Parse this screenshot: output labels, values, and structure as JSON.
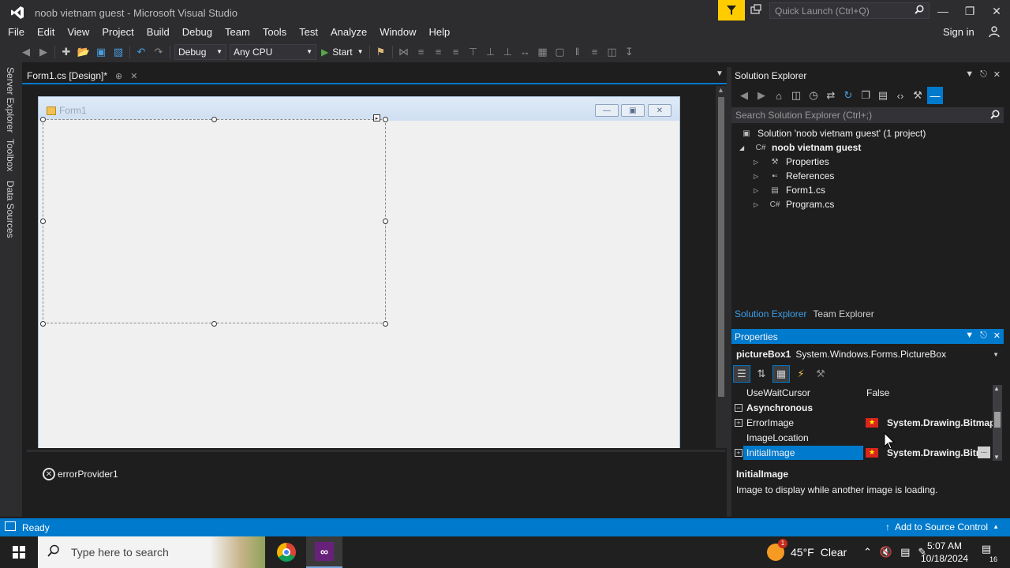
{
  "window": {
    "title": "noob vietnam guest - Microsoft Visual Studio"
  },
  "quick_launch": {
    "placeholder": "Quick Launch (Ctrl+Q)"
  },
  "menu": [
    "File",
    "Edit",
    "View",
    "Project",
    "Build",
    "Debug",
    "Team",
    "Tools",
    "Test",
    "Analyze",
    "Window",
    "Help"
  ],
  "signin": "Sign in",
  "toolbar": {
    "config": "Debug",
    "platform": "Any CPU",
    "start_label": "Start"
  },
  "side_tabs": [
    "Server Explorer",
    "Toolbox",
    "Data Sources"
  ],
  "document_tab": {
    "label": "Form1.cs [Design]*"
  },
  "designer": {
    "form_title": "Form1"
  },
  "tray": {
    "component": "errorProvider1"
  },
  "solution_explorer": {
    "title": "Solution Explorer",
    "search_placeholder": "Search Solution Explorer (Ctrl+;)",
    "tree": [
      {
        "label": "Solution 'noob vietnam guest' (1 project)",
        "icon": "solution-icon",
        "level": 0
      },
      {
        "label": "noob vietnam guest",
        "icon": "csharp-project-icon",
        "level": 1,
        "expanded": true,
        "bold": true
      },
      {
        "label": "Properties",
        "icon": "wrench-icon",
        "level": 2
      },
      {
        "label": "References",
        "icon": "references-icon",
        "level": 2
      },
      {
        "label": "Form1.cs",
        "icon": "form-icon",
        "level": 2
      },
      {
        "label": "Program.cs",
        "icon": "csharp-file-icon",
        "level": 2
      }
    ],
    "bottom_tabs": [
      "Solution Explorer",
      "Team Explorer"
    ]
  },
  "properties": {
    "title": "Properties",
    "object_name": "pictureBox1",
    "object_type": "System.Windows.Forms.PictureBox",
    "rows": [
      {
        "name": "UseWaitCursor",
        "value": "False"
      },
      {
        "name": "Asynchronous",
        "category": true
      },
      {
        "name": "ErrorImage",
        "value": "System.Drawing.Bitmap",
        "expandable": true,
        "flag": true
      },
      {
        "name": "ImageLocation",
        "value": ""
      },
      {
        "name": "InitialImage",
        "value": "System.Drawing.Bitm",
        "expandable": true,
        "flag": true,
        "selected": true
      }
    ],
    "desc_title": "InitialImage",
    "desc_text": "Image to display while another image is loading."
  },
  "status": {
    "text": "Ready",
    "source_control": "Add to Source Control"
  },
  "taskbar": {
    "search_placeholder": "Type here to search",
    "weather_temp": "45°F",
    "weather_text": "Clear",
    "weather_badge": "1",
    "time": "5:07 AM",
    "date": "10/18/2024",
    "notifications": "16"
  },
  "colors": {
    "accent": "#007acc",
    "background": "#1e1e1e",
    "chrome": "#2d2d30"
  }
}
